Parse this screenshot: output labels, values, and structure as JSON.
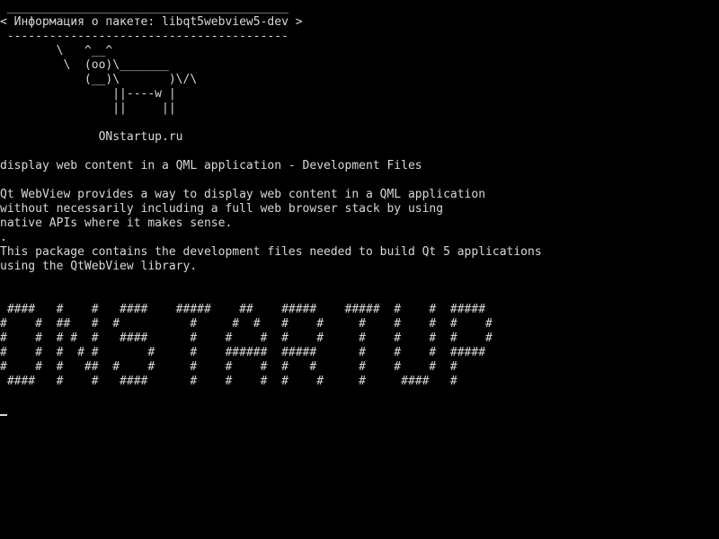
{
  "colors": {
    "background": "#000000",
    "foreground": "#d8d8d8"
  },
  "cowsay": {
    "border_top": " ________________________________________",
    "message": "< Информация о пакете: libqt5webview5-dev >",
    "border_bottom": " ----------------------------------------",
    "cow_1": "        \\   ^__^",
    "cow_2": "         \\  (oo)\\_______",
    "cow_3": "            (__)\\       )\\/\\",
    "cow_4": "                ||----w |",
    "cow_5": "                ||     ||"
  },
  "site": "              ONstartup.ru",
  "package": {
    "summary": "display web content in a QML application - Development Files",
    "desc_1": "Qt WebView provides a way to display web content in a QML application",
    "desc_2": "without necessarily including a full web browser stack by using",
    "desc_3": "native APIs where it makes sense.",
    "desc_4": ".",
    "desc_5": "This package contains the development files needed to build Qt 5 applications",
    "desc_6": "using the QtWebView library."
  },
  "banner": {
    "row_1": " ####   #    #   ####    #####    ##    #####    #####  #    #  #####",
    "row_2": "#    #  ##   #  #          #     #  #   #    #     #    #    #  #    #",
    "row_3": "#    #  # #  #   ####      #    #    #  #    #     #    #    #  #    #",
    "row_4": "#    #  #  # #       #     #    ######  #####      #    #    #  #####",
    "row_5": "#    #  #   ##  #    #     #    #    #  #   #      #    #    #  #",
    "row_6": " ####   #    #   ####      #    #    #  #    #     #     ####   #"
  }
}
